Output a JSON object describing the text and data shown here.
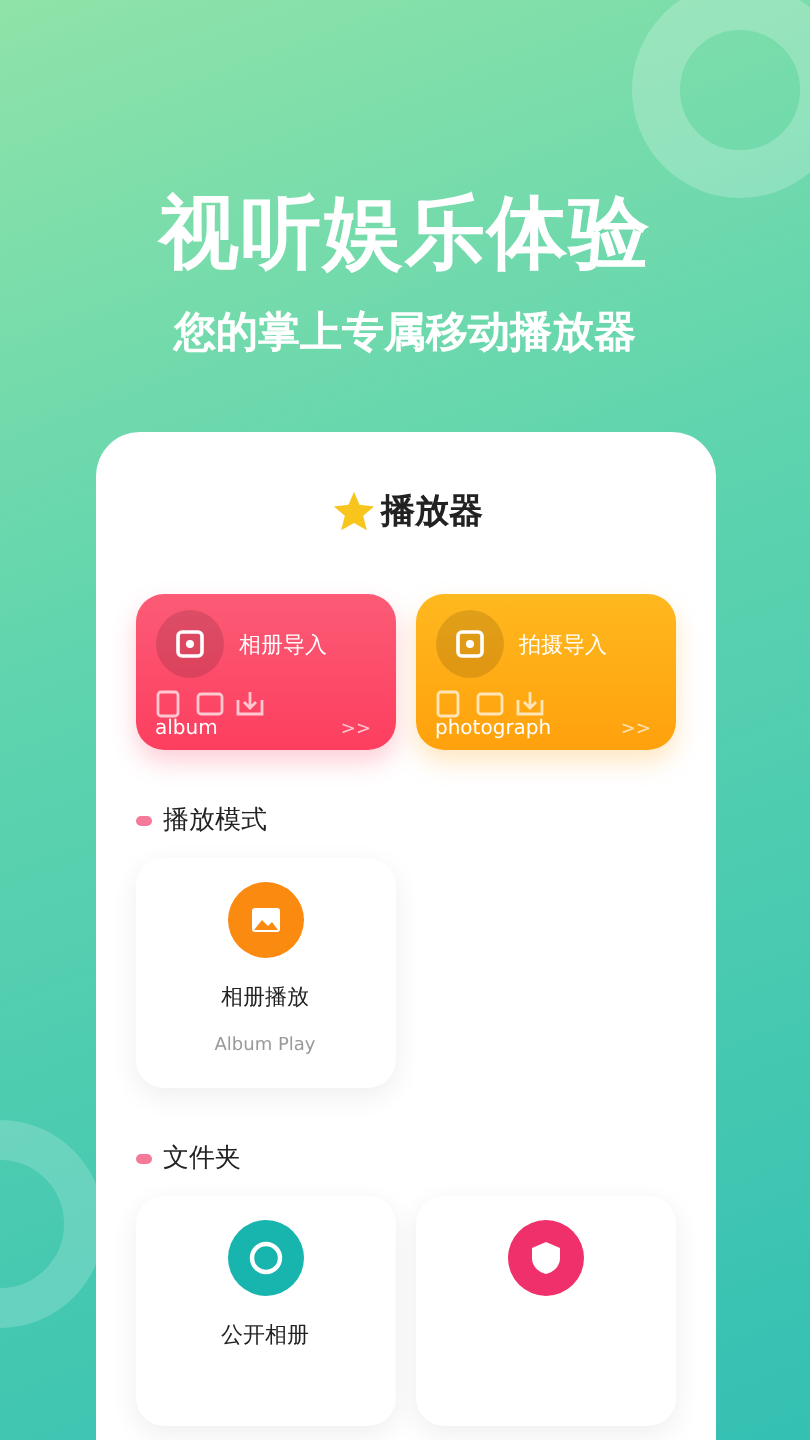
{
  "headline": "视听娱乐体验",
  "subtitle": "您的掌上专属移动播放器",
  "app": {
    "title": "播放器"
  },
  "import_cards": [
    {
      "kind": "album",
      "label": "相册导入",
      "caption": "album",
      "arrows": ">>"
    },
    {
      "kind": "photo",
      "label": "拍摄导入",
      "caption": "photograph",
      "arrows": ">>"
    }
  ],
  "sections": [
    {
      "title": "播放模式",
      "items": [
        {
          "kind": "image",
          "label": "相册播放",
          "sublabel": "Album Play"
        }
      ]
    },
    {
      "title": "文件夹",
      "items": [
        {
          "kind": "public",
          "label": "公开相册"
        },
        {
          "kind": "private"
        }
      ]
    }
  ]
}
